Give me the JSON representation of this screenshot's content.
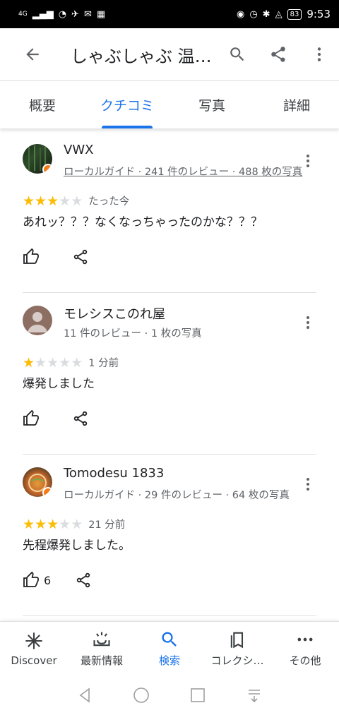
{
  "status_bar": {
    "network": "4G",
    "battery": "83",
    "time": "9:53"
  },
  "app_bar": {
    "title": "しゃぶしゃぶ 温…"
  },
  "tabs": [
    {
      "label": "概要",
      "active": false
    },
    {
      "label": "クチコミ",
      "active": true
    },
    {
      "label": "写真",
      "active": false
    },
    {
      "label": "詳細",
      "active": false
    }
  ],
  "reviews": [
    {
      "name": "VWX",
      "meta": "ローカルガイド · 241 件のレビュー · 488 枚の写真",
      "rating": 3,
      "time": "たった今",
      "text": "あれッ？？？なくなっちゃったのかな？？？",
      "likes": ""
    },
    {
      "name": "モレシスこのれ屋",
      "meta": "11 件のレビュー · 1 枚の写真",
      "rating": 1,
      "time": "1 分前",
      "text": "爆発しました",
      "likes": ""
    },
    {
      "name": "Tomodesu 1833",
      "meta": "ローカルガイド · 29 件のレビュー · 64 枚の写真",
      "rating": 3,
      "time": "21 分前",
      "text": "先程爆発しました。",
      "likes": "6"
    }
  ],
  "bottom_nav": [
    {
      "label": "Discover",
      "icon": "discover-icon"
    },
    {
      "label": "最新情報",
      "icon": "updates-icon"
    },
    {
      "label": "検索",
      "icon": "search-icon",
      "active": true
    },
    {
      "label": "コレクシ…",
      "icon": "collections-icon"
    },
    {
      "label": "その他",
      "icon": "more-icon"
    }
  ],
  "colors": {
    "accent": "#1a73e8",
    "star": "#fbbc04",
    "badge": "#f47b16"
  }
}
